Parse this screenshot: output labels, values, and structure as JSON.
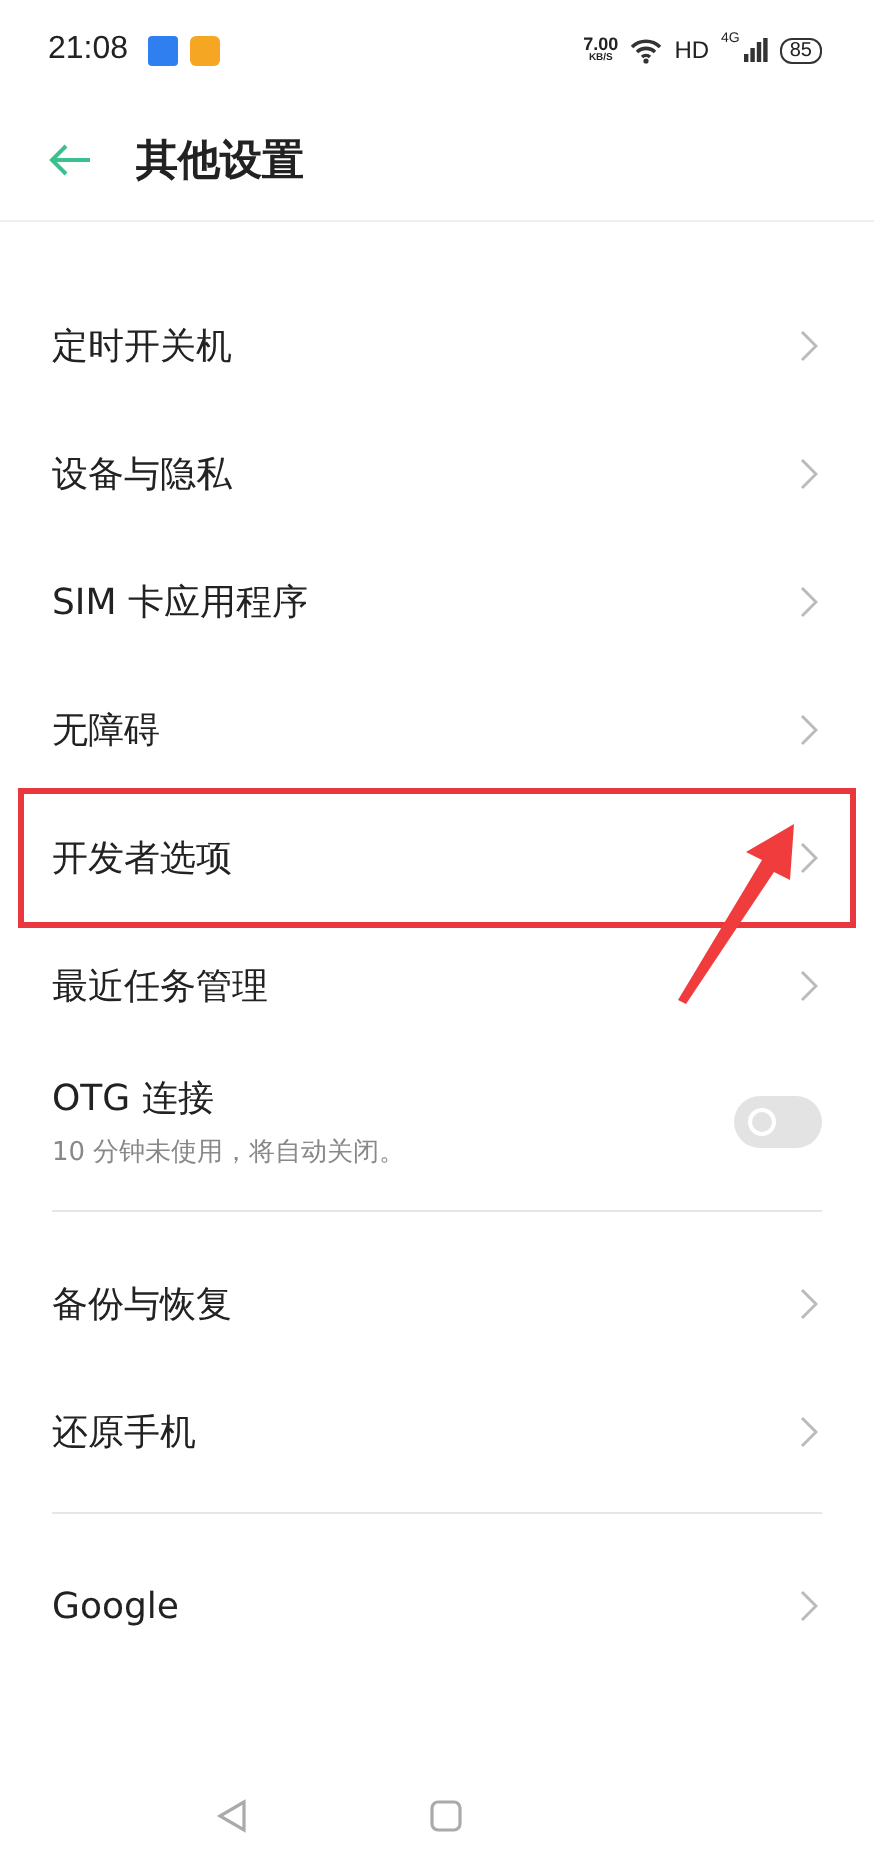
{
  "status_bar": {
    "time": "21:08",
    "speed": "7.00",
    "speed_unit": "KB/S",
    "hd": "HD",
    "network": "4G",
    "battery": "85"
  },
  "header": {
    "title": "其他设置"
  },
  "sections": [
    {
      "items": [
        {
          "kind": "link",
          "label": "定时开关机"
        },
        {
          "kind": "link",
          "label": "设备与隐私"
        },
        {
          "kind": "link",
          "label": "SIM 卡应用程序"
        },
        {
          "kind": "link",
          "label": "无障碍"
        },
        {
          "kind": "link",
          "label": "开发者选项",
          "highlighted": true
        },
        {
          "kind": "link",
          "label": "最近任务管理"
        },
        {
          "kind": "toggle",
          "label": "OTG 连接",
          "sub": "10 分钟未使用，将自动关闭。",
          "on": false
        }
      ]
    },
    {
      "items": [
        {
          "kind": "link",
          "label": "备份与恢复"
        },
        {
          "kind": "link",
          "label": "还原手机"
        }
      ]
    },
    {
      "items": [
        {
          "kind": "link",
          "label": "Google"
        }
      ]
    }
  ]
}
